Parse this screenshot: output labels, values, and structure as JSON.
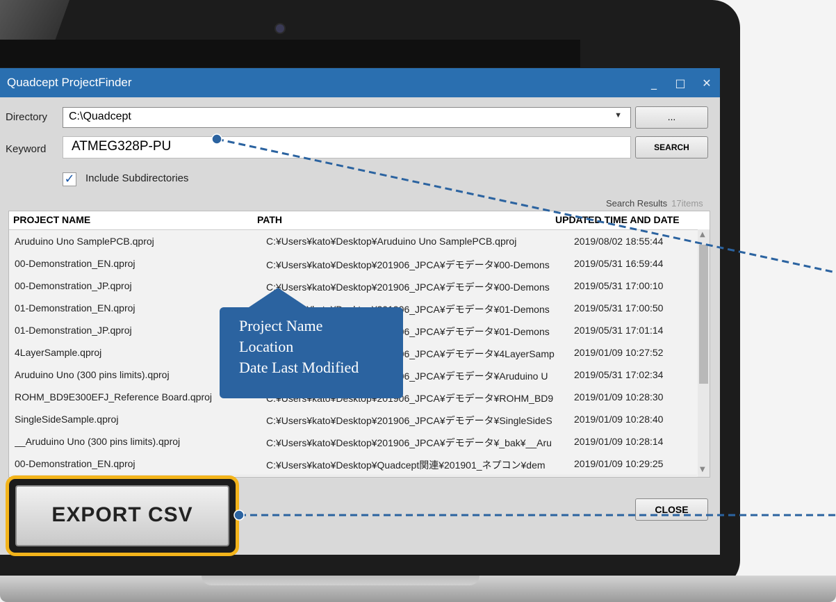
{
  "window": {
    "title": "Quadcept ProjectFinder",
    "controls": {
      "minimize": "_",
      "maximize": "□",
      "close": "✕"
    }
  },
  "form": {
    "directory_label": "Directory",
    "directory_value": "C:\\Quadcept",
    "browse_label": "...",
    "keyword_label": "Keyword",
    "keyword_value": "ATMEG328P-PU",
    "search_label": "SEARCH",
    "include_subdirs_label": "Include Subdirectories",
    "include_subdirs_checked": true
  },
  "results": {
    "label": "Search Results",
    "count": "17items",
    "columns": [
      "PROJECT NAME",
      "PATH",
      "UPDATED TIME AND DATE"
    ],
    "rows": [
      [
        "Aruduino Uno SamplePCB.qproj",
        "C:¥Users¥kato¥Desktop¥Aruduino Uno SamplePCB.qproj",
        "2019/08/02 18:55:44"
      ],
      [
        "00-Demonstration_EN.qproj",
        "C:¥Users¥kato¥Desktop¥201906_JPCA¥デモデータ¥00-Demons",
        "2019/05/31 16:59:44"
      ],
      [
        "00-Demonstration_JP.qproj",
        "C:¥Users¥kato¥Desktop¥201906_JPCA¥デモデータ¥00-Demons",
        "2019/05/31 17:00:10"
      ],
      [
        "01-Demonstration_EN.qproj",
        "C:¥Users¥kato¥Desktop¥201906_JPCA¥デモデータ¥01-Demons",
        "2019/05/31 17:00:50"
      ],
      [
        "01-Demonstration_JP.qproj",
        "C:¥Users¥kato¥Desktop¥201906_JPCA¥デモデータ¥01-Demons",
        "2019/05/31 17:01:14"
      ],
      [
        "4LayerSample.qproj",
        "C:¥Users¥kato¥Desktop¥201906_JPCA¥デモデータ¥4LayerSamp",
        "2019/01/09 10:27:52"
      ],
      [
        "Aruduino Uno (300 pins limits).qproj",
        "C:¥Users¥kato¥Desktop¥201906_JPCA¥デモデータ¥Aruduino U",
        "2019/05/31 17:02:34"
      ],
      [
        "ROHM_BD9E300EFJ_Reference Board.qproj",
        "C:¥Users¥kato¥Desktop¥201906_JPCA¥デモデータ¥ROHM_BD9",
        "2019/01/09 10:28:30"
      ],
      [
        "SingleSideSample.qproj",
        "C:¥Users¥kato¥Desktop¥201906_JPCA¥デモデータ¥SingleSideS",
        "2019/01/09 10:28:40"
      ],
      [
        "__Aruduino Uno (300 pins limits).qproj",
        "C:¥Users¥kato¥Desktop¥201906_JPCA¥デモデータ¥_bak¥__Aru",
        "2019/01/09 10:28:14"
      ],
      [
        "00-Demonstration_EN.qproj",
        "C:¥Users¥kato¥Desktop¥Quadcept関連¥201901_ネプコン¥dem",
        "2019/01/09 10:29:25"
      ]
    ]
  },
  "buttons": {
    "close_label": "CLOSE",
    "export_label": "EXPORT CSV"
  },
  "callout": {
    "line1": "Project Name",
    "line2": "Location",
    "line3": "Date Last Modified"
  },
  "colors": {
    "titlebar": "#2a6fb0",
    "callout": "#2b63a0",
    "highlight": "#f3b41b"
  }
}
